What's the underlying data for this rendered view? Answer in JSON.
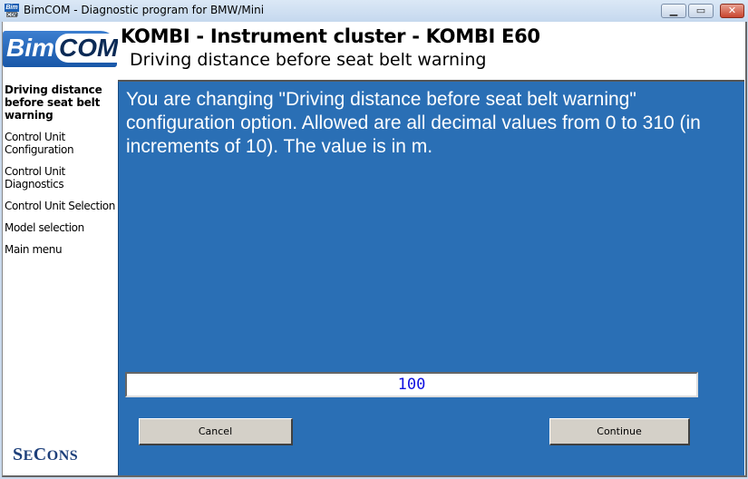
{
  "window": {
    "title": "BimCOM - Diagnostic program for BMW/Mini",
    "icon_top": "Bim",
    "icon_bottom": "COM",
    "controls": {
      "minimize": "minimize-icon",
      "maximize": "maximize-icon",
      "close": "close-icon"
    }
  },
  "logo": {
    "part1": "Bim",
    "part2": "COM"
  },
  "header": {
    "title": "KOMBI - Instrument cluster - KOMBI E60",
    "subtitle": "Driving distance before seat belt warning"
  },
  "sidebar": {
    "items": [
      {
        "label": "Driving distance before seat belt warning",
        "active": true
      },
      {
        "label": "Control Unit Configuration",
        "active": false
      },
      {
        "label": "Control Unit Diagnostics",
        "active": false
      },
      {
        "label": "Control Unit Selection",
        "active": false
      },
      {
        "label": "Model selection",
        "active": false
      },
      {
        "label": "Main menu",
        "active": false
      }
    ],
    "footer_logo": "SECONS"
  },
  "main": {
    "message": "You are changing \"Driving distance before seat belt warning\" configuration option. Allowed are all decimal values from 0 to 310 (in increments of 10). The value is in m.",
    "value": "100",
    "cancel_label": "Cancel",
    "continue_label": "Continue"
  },
  "colors": {
    "main_bg": "#2a6fb5",
    "value_text": "#1010e0",
    "button_bg": "#d4d0c8"
  }
}
